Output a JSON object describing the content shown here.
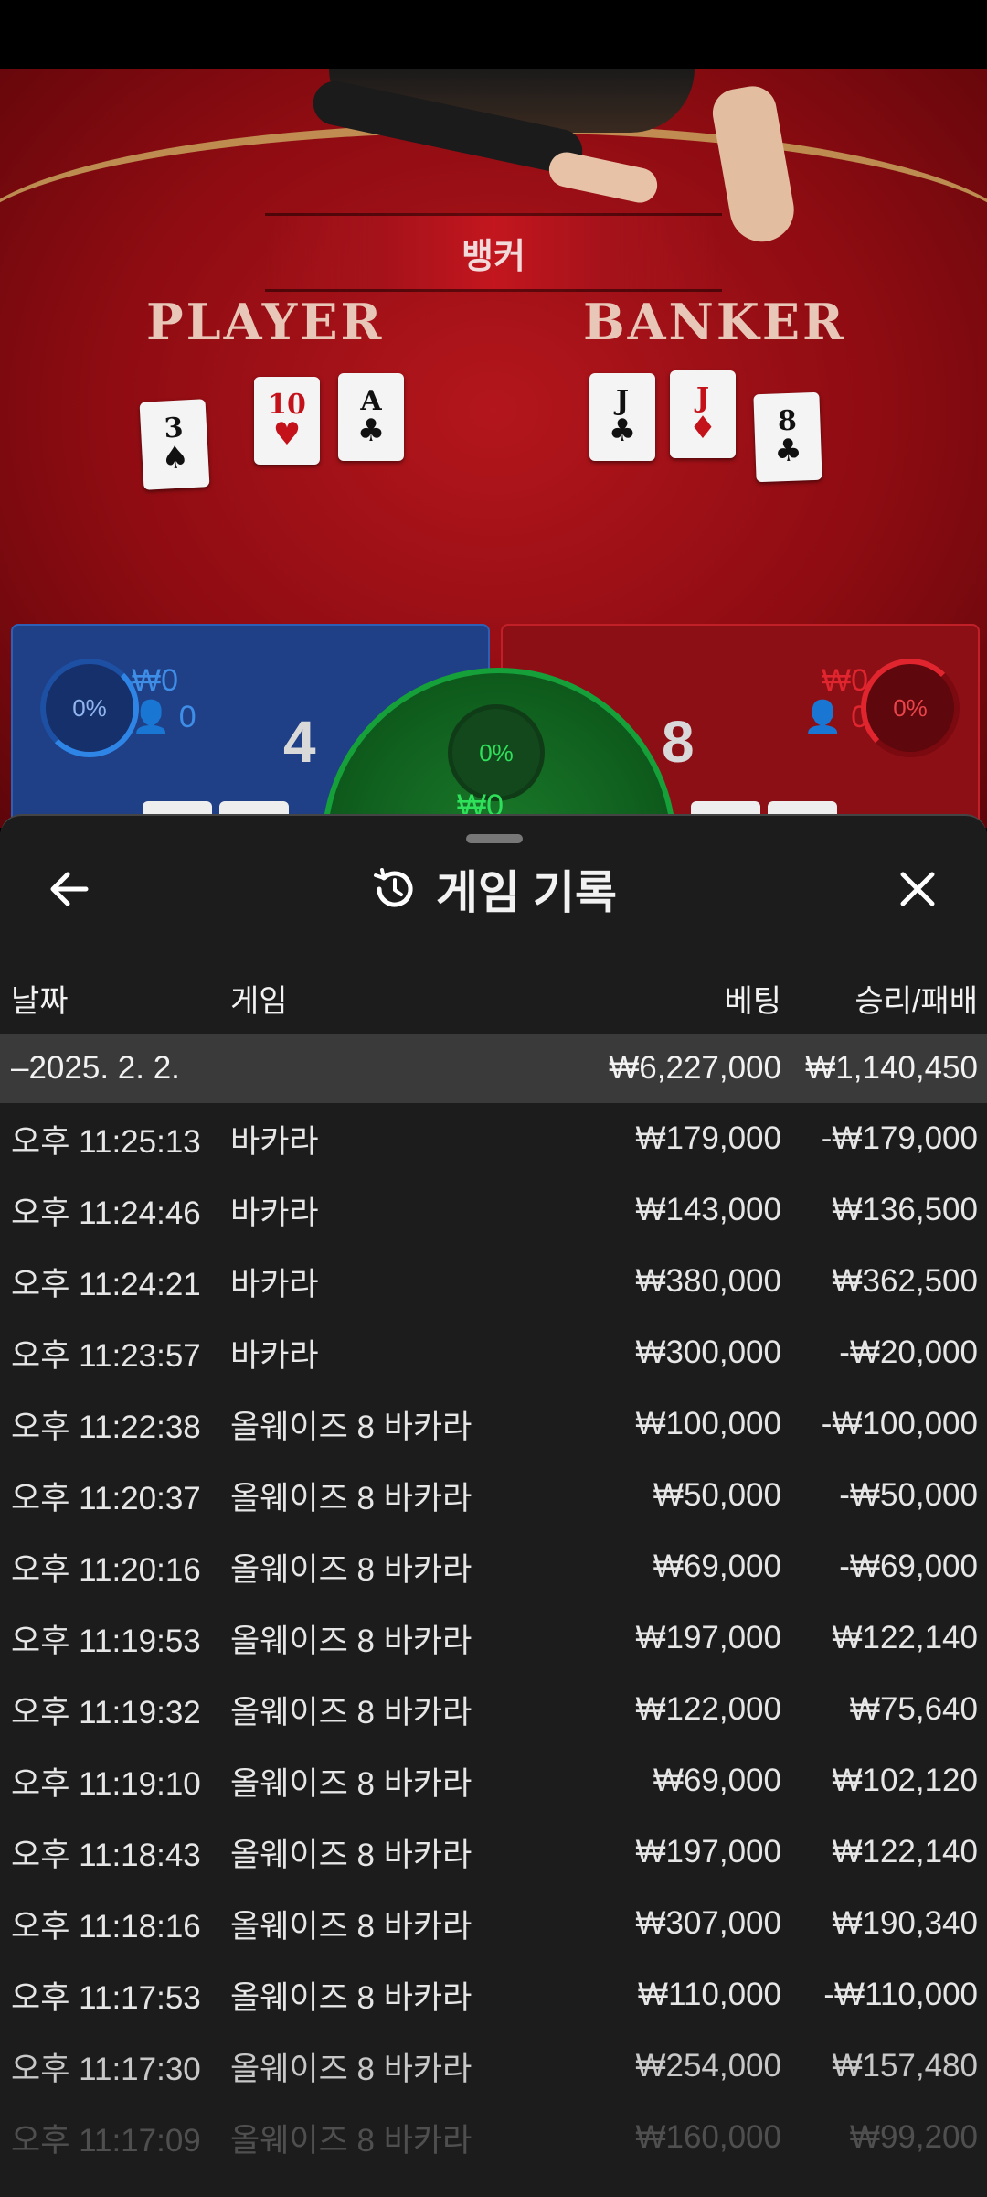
{
  "table": {
    "result_banner": "뱅커",
    "player_title": "PLAYER",
    "banker_title": "BANKER",
    "player_cards": [
      {
        "rank": "3",
        "suit": "♠",
        "color": "black"
      },
      {
        "rank": "10",
        "suit": "♥",
        "color": "red"
      },
      {
        "rank": "A",
        "suit": "♣",
        "color": "black"
      }
    ],
    "banker_cards": [
      {
        "rank": "J",
        "suit": "♣",
        "color": "black"
      },
      {
        "rank": "J",
        "suit": "♦",
        "color": "red"
      },
      {
        "rank": "8",
        "suit": "♣",
        "color": "black"
      }
    ],
    "player": {
      "percent": "0%",
      "amount": "₩0",
      "count": "0",
      "score": "4"
    },
    "banker": {
      "percent": "0%",
      "amount": "₩0",
      "count": "0",
      "score": "8"
    },
    "tie": {
      "percent": "0%",
      "amount": "₩0"
    },
    "colors": {
      "player": "#1f3f86",
      "banker": "#8c0f16",
      "tie": "#0e5a1c"
    }
  },
  "history": {
    "title": "게임 기록",
    "icons": {
      "back": "arrow-left-icon",
      "history": "history-clock-icon",
      "close": "close-icon"
    },
    "columns": {
      "date": "날짜",
      "game": "게임",
      "bet": "베팅",
      "winloss": "승리/패배"
    },
    "date_group": {
      "label": "–2025. 2. 2.",
      "bet_total": "₩6,227,000",
      "winloss_total": "₩1,140,450"
    },
    "rows": [
      {
        "time": "오후 11:25:13",
        "game": "바카라",
        "bet": "₩179,000",
        "winloss": "-₩179,000"
      },
      {
        "time": "오후 11:24:46",
        "game": "바카라",
        "bet": "₩143,000",
        "winloss": "₩136,500"
      },
      {
        "time": "오후 11:24:21",
        "game": "바카라",
        "bet": "₩380,000",
        "winloss": "₩362,500"
      },
      {
        "time": "오후 11:23:57",
        "game": "바카라",
        "bet": "₩300,000",
        "winloss": "-₩20,000"
      },
      {
        "time": "오후 11:22:38",
        "game": "올웨이즈 8 바카라",
        "bet": "₩100,000",
        "winloss": "-₩100,000"
      },
      {
        "time": "오후 11:20:37",
        "game": "올웨이즈 8 바카라",
        "bet": "₩50,000",
        "winloss": "-₩50,000"
      },
      {
        "time": "오후 11:20:16",
        "game": "올웨이즈 8 바카라",
        "bet": "₩69,000",
        "winloss": "-₩69,000"
      },
      {
        "time": "오후 11:19:53",
        "game": "올웨이즈 8 바카라",
        "bet": "₩197,000",
        "winloss": "₩122,140"
      },
      {
        "time": "오후 11:19:32",
        "game": "올웨이즈 8 바카라",
        "bet": "₩122,000",
        "winloss": "₩75,640"
      },
      {
        "time": "오후 11:19:10",
        "game": "올웨이즈 8 바카라",
        "bet": "₩69,000",
        "winloss": "₩102,120"
      },
      {
        "time": "오후 11:18:43",
        "game": "올웨이즈 8 바카라",
        "bet": "₩197,000",
        "winloss": "₩122,140"
      },
      {
        "time": "오후 11:18:16",
        "game": "올웨이즈 8 바카라",
        "bet": "₩307,000",
        "winloss": "₩190,340"
      },
      {
        "time": "오후 11:17:53",
        "game": "올웨이즈 8 바카라",
        "bet": "₩110,000",
        "winloss": "-₩110,000"
      },
      {
        "time": "오후 11:17:30",
        "game": "올웨이즈 8 바카라",
        "bet": "₩254,000",
        "winloss": "₩157,480"
      },
      {
        "time": "오후 11:17:09",
        "game": "올웨이즈 8 바카라",
        "bet": "₩160,000",
        "winloss": "₩99,200"
      }
    ]
  }
}
